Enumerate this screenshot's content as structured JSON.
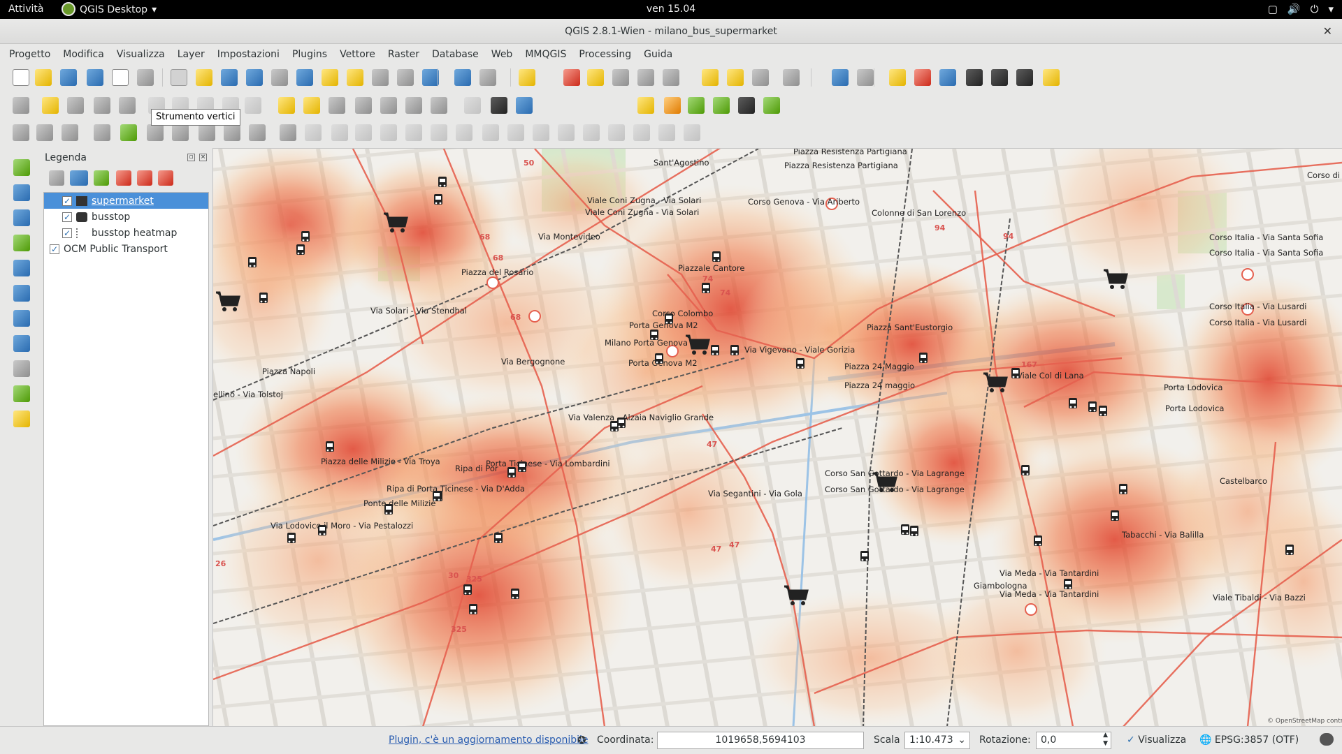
{
  "topbar": {
    "activities": "Attività",
    "app_name": "QGIS Desktop",
    "clock": "ven 15.04"
  },
  "window": {
    "title": "QGIS 2.8.1-Wien - milano_bus_supermarket",
    "close_icon": "close-icon"
  },
  "menu": {
    "items": [
      "Progetto",
      "Modifica",
      "Visualizza",
      "Layer",
      "Impostazioni",
      "Plugins",
      "Vettore",
      "Raster",
      "Database",
      "Web",
      "MMQGIS",
      "Processing",
      "Guida"
    ]
  },
  "tooltip": "Strumento vertici",
  "legend": {
    "title": "Legenda",
    "layers": [
      {
        "name": "supermarket",
        "checked": true,
        "selected": true,
        "icon": "supermarket-layer-icon"
      },
      {
        "name": "busstop",
        "checked": true,
        "selected": false,
        "icon": "busstop-layer-icon"
      },
      {
        "name": "busstop heatmap",
        "checked": true,
        "selected": false,
        "icon": "raster-layer-icon"
      },
      {
        "name": "OCM Public Transport",
        "checked": true,
        "selected": false,
        "icon": "wms-layer-icon"
      }
    ]
  },
  "map": {
    "places": [
      "Sant'Agostino",
      "Piazza Resistenza Partigiana",
      "Piazza Resistenza Partigiana",
      "Viale Coni Zugna - Via Solari",
      "Viale Coni Zugna - Via Solari",
      "Corso Genova - Via Ariberto",
      "Colonne di San Lorenzo",
      "Corso Italia - Via Santa Sofia",
      "Corso Italia - Via Santa Sofia",
      "Via Montevideo",
      "Piazza del Rosario",
      "Piazzale Cantore",
      "Via Solari - Via Stendhal",
      "Corso Colombo",
      "Porta Genova M2",
      "Milano Porta Genova",
      "Porta Genova M2",
      "Via Vigevano - Viale Gorizia",
      "Piazza Sant'Eustorgio",
      "Corso Italia - Via Lusardi",
      "Corso Italia - Via Lusardi",
      "Via Bergognone",
      "Piazza Napoli",
      "ellino - Via Tolstoj",
      "Piazza 24 Maggio",
      "Piazza 24 maggio",
      "Viale Col di Lana",
      "Porta Lodovica",
      "Porta Lodovica",
      "Via Valenza - Alzaia Naviglio Grande",
      "Piazza delle Milizie - Via Troya",
      "Porta Ticinese - Via Lombardini",
      "Ripa di Por",
      "Ripa di Porta Ticinese - Via D'Adda",
      "Ponte delle Milizie",
      "Via Lodovico il Moro - Via Pestalozzi",
      "Corso San Gottardo - Via Lagrange",
      "Corso San Gottardo - Via Lagrange",
      "Via Segantini - Via Gola",
      "Castelbarco",
      "Tabacchi - Via Balilla",
      "Via Meda - Via Tantardini",
      "Via Meda - Via Tantardini",
      "Giambologna",
      "Corso di",
      "Viale Tibaldi - Via Bazzi"
    ],
    "attribution": "© OpenStreetMap contributors",
    "route_numbers": [
      "50",
      "68",
      "68",
      "68",
      "94",
      "94",
      "74",
      "74",
      "167",
      "47",
      "47",
      "325",
      "325",
      "47",
      "30",
      "26"
    ]
  },
  "status": {
    "plugin_msg": "Plugin, c'è un aggiornamento disponibile",
    "coord_label": "Coordinata:",
    "coord_value": "1019658,5694103",
    "scale_label": "Scala",
    "scale_value": "1:10.473",
    "rotation_label": "Rotazione:",
    "rotation_value": "0,0",
    "render_label": "Visualizza",
    "crs": "EPSG:3857 (OTF)"
  }
}
